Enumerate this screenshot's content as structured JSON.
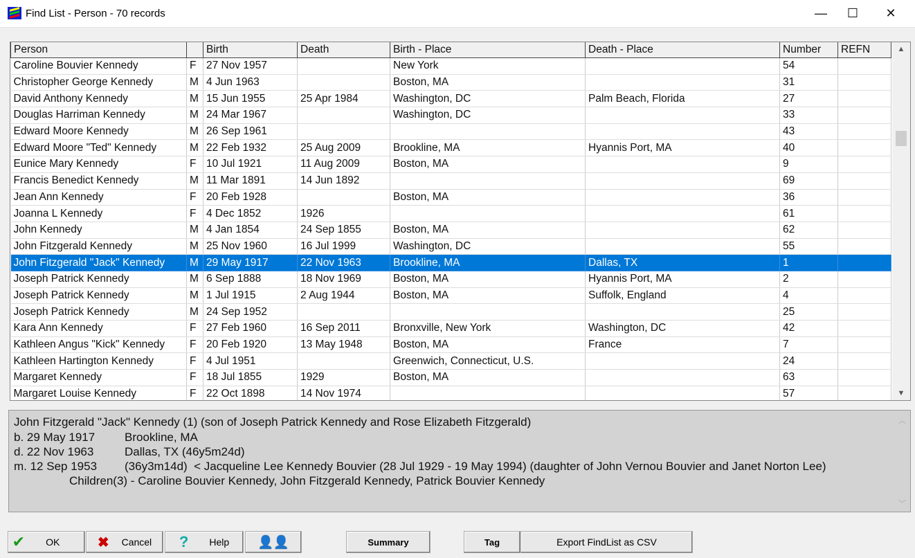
{
  "window": {
    "title": "Find List - Person - 70 records",
    "minimize": "—",
    "maximize": "☐",
    "close": "✕"
  },
  "columns": [
    "Person",
    "",
    "Birth",
    "Death",
    "Birth - Place",
    "Death - Place",
    "Number",
    "REFN"
  ],
  "rows": [
    [
      "Caroline Bouvier Kennedy",
      "F",
      "27 Nov 1957",
      "",
      "New York",
      "",
      "54",
      ""
    ],
    [
      "Christopher George Kennedy",
      "M",
      "4 Jun 1963",
      "",
      "Boston, MA",
      "",
      "31",
      ""
    ],
    [
      "David Anthony Kennedy",
      "M",
      "15 Jun 1955",
      "25 Apr 1984",
      "Washington, DC",
      "Palm Beach, Florida",
      "27",
      ""
    ],
    [
      "Douglas Harriman Kennedy",
      "M",
      "24 Mar 1967",
      "",
      "Washington, DC",
      "",
      "33",
      ""
    ],
    [
      "Edward Moore Kennedy",
      "M",
      "26 Sep 1961",
      "",
      "",
      "",
      "43",
      ""
    ],
    [
      "Edward Moore \"Ted\" Kennedy",
      "M",
      "22 Feb 1932",
      "25 Aug 2009",
      "Brookline, MA",
      "Hyannis Port, MA",
      "40",
      ""
    ],
    [
      "Eunice Mary Kennedy",
      "F",
      "10 Jul 1921",
      "11 Aug 2009",
      "Boston, MA",
      "",
      "9",
      ""
    ],
    [
      "Francis Benedict Kennedy",
      "M",
      "11 Mar 1891",
      "14 Jun 1892",
      "",
      "",
      "69",
      ""
    ],
    [
      "Jean Ann Kennedy",
      "F",
      "20 Feb 1928",
      "",
      "Boston, MA",
      "",
      "36",
      ""
    ],
    [
      "Joanna L Kennedy",
      "F",
      "4 Dec 1852",
      "1926",
      "",
      "",
      "61",
      ""
    ],
    [
      "John Kennedy",
      "M",
      "4 Jan 1854",
      "24 Sep 1855",
      "Boston, MA",
      "",
      "62",
      ""
    ],
    [
      "John Fitzgerald Kennedy",
      "M",
      "25 Nov 1960",
      "16 Jul 1999",
      "Washington, DC",
      "",
      "55",
      ""
    ],
    [
      "John Fitzgerald \"Jack\" Kennedy",
      "M",
      "29 May 1917",
      "22 Nov 1963",
      "Brookline, MA",
      "Dallas, TX",
      "1",
      ""
    ],
    [
      "Joseph Patrick Kennedy",
      "M",
      "6 Sep 1888",
      "18 Nov 1969",
      "Boston, MA",
      "Hyannis Port, MA",
      "2",
      ""
    ],
    [
      "Joseph Patrick Kennedy",
      "M",
      "1 Jul 1915",
      "2 Aug 1944",
      "Boston, MA",
      "Suffolk, England",
      "4",
      ""
    ],
    [
      "Joseph Patrick Kennedy",
      "M",
      "24 Sep 1952",
      "",
      "",
      "",
      "25",
      ""
    ],
    [
      "Kara Ann Kennedy",
      "F",
      "27 Feb 1960",
      "16 Sep 2011",
      "Bronxville, New York",
      "Washington, DC",
      "42",
      ""
    ],
    [
      "Kathleen Angus \"Kick\" Kennedy",
      "F",
      "20 Feb 1920",
      "13 May 1948",
      "Boston, MA",
      "France",
      "7",
      ""
    ],
    [
      "Kathleen Hartington Kennedy",
      "F",
      "4 Jul 1951",
      "",
      "Greenwich, Connecticut, U.S.",
      "",
      "24",
      ""
    ],
    [
      "Margaret Kennedy",
      "F",
      "18 Jul 1855",
      "1929",
      "Boston, MA",
      "",
      "63",
      ""
    ],
    [
      "Margaret Louise Kennedy",
      "F",
      "22 Oct 1898",
      "14 Nov 1974",
      "",
      "",
      "57",
      ""
    ]
  ],
  "selected_row": 12,
  "detail": {
    "line1": "John Fitzgerald \"Jack\" Kennedy (1) (son of Joseph Patrick Kennedy and Rose Elizabeth Fitzgerald)",
    "b_label": "b. 29 May 1917",
    "b_place": "Brookline, MA",
    "d_label": "d. 22 Nov 1963",
    "d_place": "Dallas, TX (46y5m24d)",
    "m_label": "m. 12 Sep 1953",
    "m_text": "(36y3m14d)  < Jacqueline Lee Kennedy Bouvier (28 Jul 1929 - 19 May 1994) (daughter of John Vernou Bouvier and Janet Norton Lee)",
    "children": "Children(3) - Caroline Bouvier Kennedy, John Fitzgerald Kennedy, Patrick Bouvier Kennedy"
  },
  "buttons": {
    "ok": "OK",
    "cancel": "Cancel",
    "help": "Help",
    "summary": "Summary",
    "tag": "Tag",
    "export": "Export FindList as CSV"
  },
  "colors": {
    "selection": "#0078d7",
    "detail_bg": "#d3d3d3"
  }
}
